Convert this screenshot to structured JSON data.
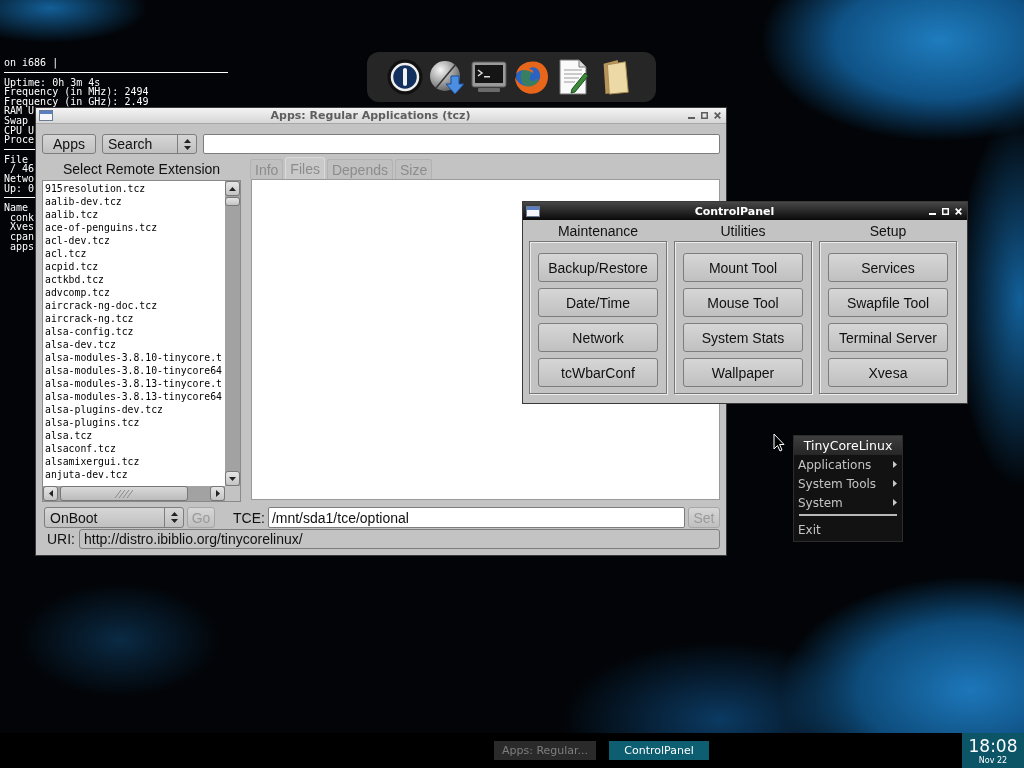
{
  "system_monitor": {
    "lines": [
      {
        "kind": "text",
        "text": "on i686 |"
      },
      {
        "kind": "rule"
      },
      {
        "kind": "text",
        "text": "Uptime: 0h 3m 4s"
      },
      {
        "kind": "text",
        "text": "Frequency (in MHz): 2494"
      },
      {
        "kind": "text",
        "text": "Frequency (in GHz): 2.49"
      },
      {
        "kind": "text",
        "text": "RAM U"
      },
      {
        "kind": "text",
        "text": "Swap"
      },
      {
        "kind": "text",
        "text": "CPU U"
      },
      {
        "kind": "text",
        "text": "Proce"
      },
      {
        "kind": "rule"
      },
      {
        "kind": "text",
        "text": "File"
      },
      {
        "kind": "indented",
        "text": "/ 46"
      },
      {
        "kind": "text",
        "text": "Netwo"
      },
      {
        "kind": "text",
        "text": "Up: 0"
      },
      {
        "kind": "rule"
      },
      {
        "kind": "text",
        "text": "Name"
      },
      {
        "kind": "indented",
        "text": "conk"
      },
      {
        "kind": "indented",
        "text": "Xves"
      },
      {
        "kind": "indented",
        "text": "cpan"
      },
      {
        "kind": "indented",
        "text": "apps"
      }
    ]
  },
  "apps_window": {
    "title": "Apps: Regular Applications (tcz)",
    "active": false,
    "mode_button": "Apps",
    "search_mode": "Search",
    "list_heading": "Select Remote Extension",
    "extensions": [
      "915resolution.tcz",
      "aalib-dev.tcz",
      "aalib.tcz",
      "ace-of-penguins.tcz",
      "acl-dev.tcz",
      "acl.tcz",
      "acpid.tcz",
      "actkbd.tcz",
      "advcomp.tcz",
      "aircrack-ng-doc.tcz",
      "aircrack-ng.tcz",
      "alsa-config.tcz",
      "alsa-dev.tcz",
      "alsa-modules-3.8.10-tinycore.t",
      "alsa-modules-3.8.10-tinycore64",
      "alsa-modules-3.8.13-tinycore.t",
      "alsa-modules-3.8.13-tinycore64",
      "alsa-plugins-dev.tcz",
      "alsa-plugins.tcz",
      "alsa.tcz",
      "alsaconf.tcz",
      "alsamixergui.tcz",
      "anjuta-dev.tcz"
    ],
    "tabs": [
      {
        "label": "Info",
        "selected": false,
        "disabled": true
      },
      {
        "label": "Files",
        "selected": true,
        "disabled": true
      },
      {
        "label": "Depends",
        "selected": false,
        "disabled": true
      },
      {
        "label": "Size",
        "selected": false,
        "disabled": true
      }
    ],
    "boot_mode": "OnBoot",
    "go_button": {
      "label": "Go",
      "disabled": true
    },
    "tce": {
      "label": "TCE:",
      "value": "/mnt/sda1/tce/optional"
    },
    "set_button": {
      "label": "Set",
      "disabled": true
    },
    "uri": {
      "label": "URI:",
      "value": "http://distro.ibiblio.org/tinycorelinux/"
    }
  },
  "control_panel": {
    "title": "ControlPanel",
    "active": true,
    "groups": [
      {
        "label": "Maintenance",
        "buttons": [
          "Backup/Restore",
          "Date/Time",
          "Network",
          "tcWbarConf"
        ]
      },
      {
        "label": "Utilities",
        "buttons": [
          "Mount Tool",
          "Mouse Tool",
          "System Stats",
          "Wallpaper"
        ]
      },
      {
        "label": "Setup",
        "buttons": [
          "Services",
          "Swapfile Tool",
          "Terminal Server",
          "Xvesa"
        ]
      }
    ]
  },
  "menu": {
    "title": "TinyCoreLinux",
    "items": [
      {
        "kind": "submenu",
        "label": "Applications"
      },
      {
        "kind": "submenu",
        "label": "System Tools"
      },
      {
        "kind": "submenu",
        "label": "System"
      },
      {
        "kind": "separator"
      },
      {
        "kind": "command",
        "label": "Exit"
      }
    ]
  },
  "taskbar": {
    "tasks": [
      {
        "label": "Apps: Regular...",
        "selected": false
      },
      {
        "label": "ControlPanel",
        "selected": true
      }
    ],
    "clock": {
      "time": "18:08",
      "date": "Nov 22"
    }
  }
}
